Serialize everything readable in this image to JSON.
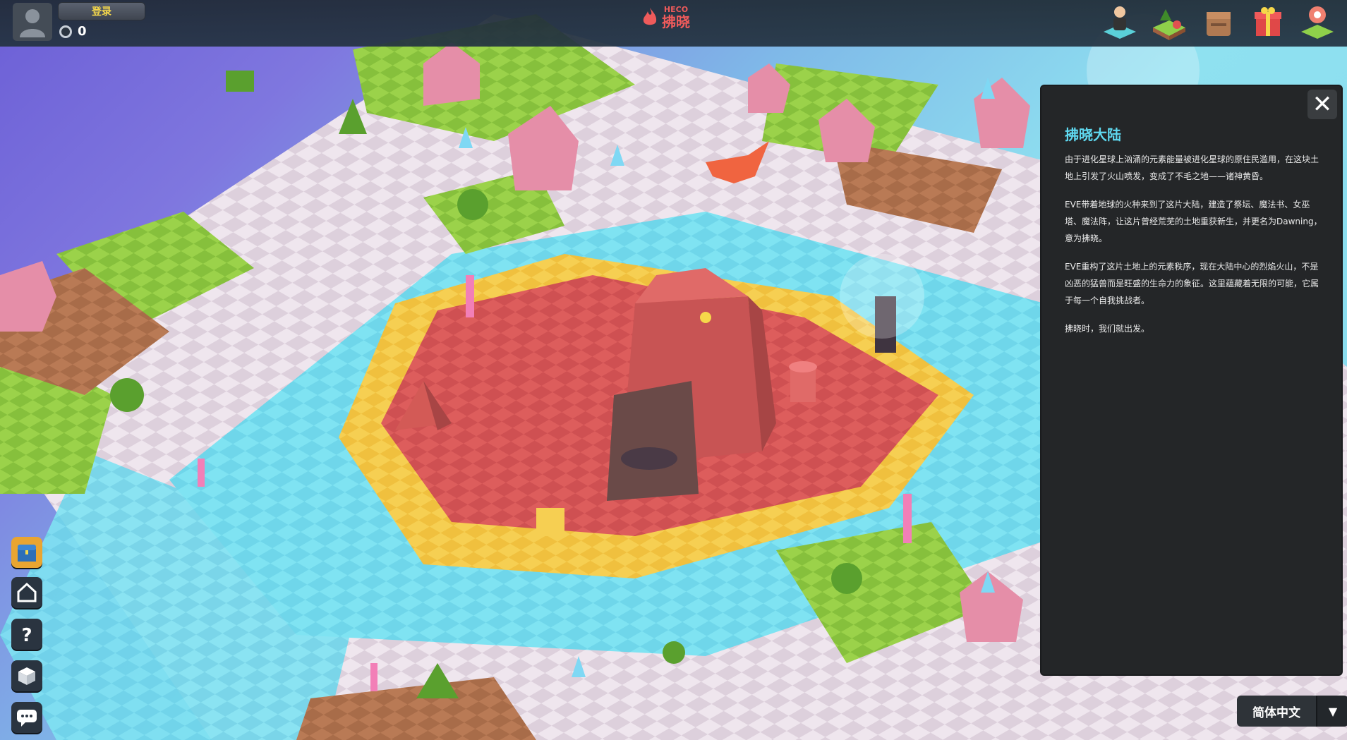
{
  "header": {
    "login_label": "登录",
    "coin_count": "0",
    "brand_name": "拂晓",
    "brand_network": "HECO"
  },
  "top_icons": [
    {
      "name": "character-icon"
    },
    {
      "name": "land-map-icon"
    },
    {
      "name": "backpack-icon"
    },
    {
      "name": "gift-box-icon"
    },
    {
      "name": "location-pin-icon"
    }
  ],
  "side_buttons": [
    {
      "name": "treasure-chest-icon"
    },
    {
      "name": "home-icon"
    },
    {
      "name": "help-question-icon"
    },
    {
      "name": "cube-icon"
    },
    {
      "name": "chat-icon"
    }
  ],
  "info_panel": {
    "title": "拂晓大陆",
    "paragraphs": [
      "由于进化星球上汹涌的元素能量被进化星球的原住民滥用，在这块土地上引发了火山喷发，变成了不毛之地——诸神黄昏。",
      "EVE带着地球的火种来到了这片大陆，建造了祭坛、魔法书、女巫塔、魔法阵，让这片曾经荒芜的土地重获新生，并更名为Dawning，意为拂晓。",
      "EVE重构了这片土地上的元素秩序，现在大陆中心的烈焰火山，不是凶恶的猛兽而是旺盛的生命力的象征。这里蕴藏着无限的可能，它属于每一个自我挑战者。",
      "拂晓时，我们就出发。"
    ],
    "close_icon": "close-icon"
  },
  "language": {
    "selected": "简体中文",
    "arrow_icon": "chevron-down-icon"
  },
  "colors": {
    "brand": "#ef5b5b",
    "panel_title": "#5fd9f0",
    "login_text": "#f6d84a"
  }
}
